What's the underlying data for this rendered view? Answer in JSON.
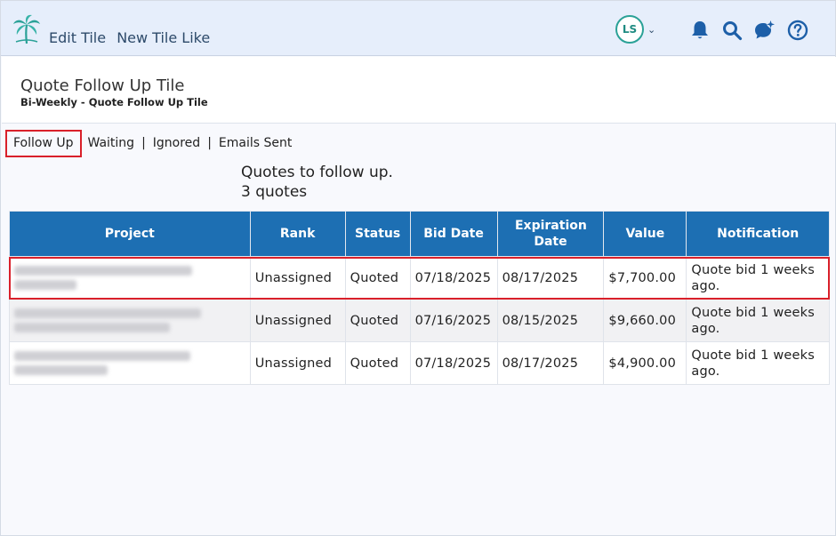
{
  "topbar": {
    "links": [
      "Edit Tile",
      "New Tile Like"
    ],
    "user_initials": "LS",
    "icons": [
      "bell-icon",
      "search-icon",
      "chat-sparkle-icon",
      "help-icon"
    ],
    "icon_color": "#1d5fa8"
  },
  "header": {
    "title": "Quote Follow Up Tile",
    "subtitle": "Bi-Weekly - Quote Follow Up Tile"
  },
  "tabs": [
    {
      "label": "Follow Up",
      "active": true
    },
    {
      "label": "Waiting",
      "active": false
    },
    {
      "label": "Ignored",
      "active": false
    },
    {
      "label": "Emails Sent",
      "active": false
    }
  ],
  "summary": {
    "line1": "Quotes to follow up.",
    "line2": "3 quotes"
  },
  "table": {
    "header_color": "#1d6fb3",
    "columns": [
      "Project",
      "Rank",
      "Status",
      "Bid Date",
      "Expiration Date",
      "Value",
      "Notification"
    ],
    "rows": [
      {
        "project": "",
        "rank": "Unassigned",
        "status": "Quoted",
        "bid_date": "07/18/2025",
        "expiration_date": "08/17/2025",
        "value": "$7,700.00",
        "notification": "Quote bid 1 weeks ago."
      },
      {
        "project": "",
        "rank": "Unassigned",
        "status": "Quoted",
        "bid_date": "07/16/2025",
        "expiration_date": "08/15/2025",
        "value": "$9,660.00",
        "notification": "Quote bid 1 weeks ago."
      },
      {
        "project": "",
        "rank": "Unassigned",
        "status": "Quoted",
        "bid_date": "07/18/2025",
        "expiration_date": "08/17/2025",
        "value": "$4,900.00",
        "notification": "Quote bid 1 weeks ago."
      }
    ]
  }
}
